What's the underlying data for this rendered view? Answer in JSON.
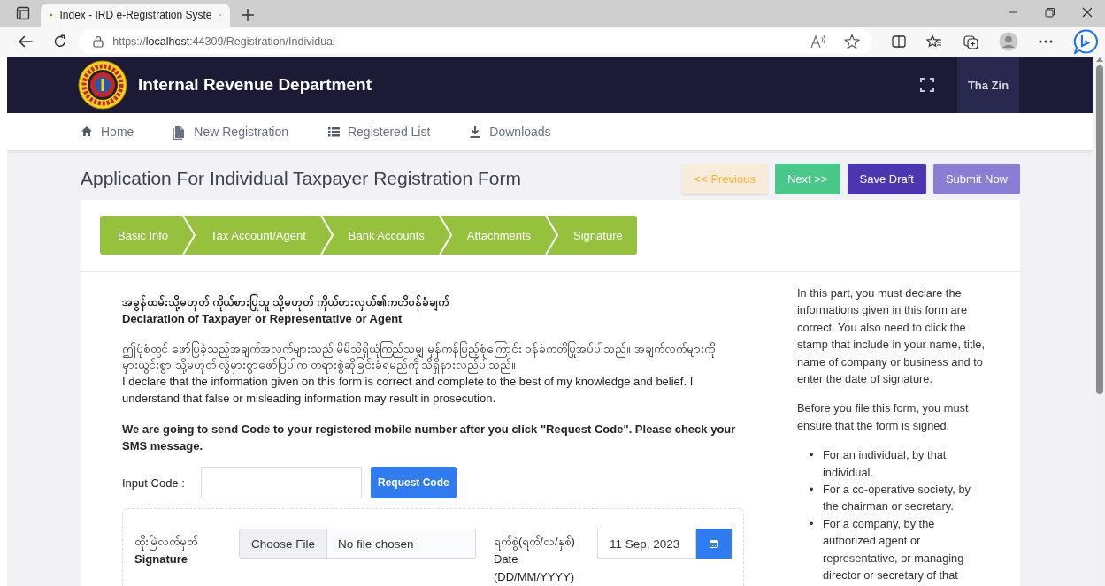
{
  "browser": {
    "tab_title": "Index - IRD e-Registration Syste",
    "url_scheme": "https://",
    "url_host": "localhost",
    "url_rest": ":44309/Registration/Individual"
  },
  "header": {
    "title": "Internal Revenue Department",
    "user": "Tha Zin"
  },
  "nav": [
    {
      "kind": "home",
      "label": "Home"
    },
    {
      "kind": "document",
      "label": "New Registration"
    },
    {
      "kind": "list",
      "label": "Registered List"
    },
    {
      "kind": "download",
      "label": "Downloads"
    }
  ],
  "page_title": "Application For Individual Taxpayer Registration Form",
  "actions": [
    {
      "kind": "previous",
      "label": "<< Previous"
    },
    {
      "kind": "next",
      "label": "Next >>"
    },
    {
      "kind": "draft",
      "label": "Save Draft"
    },
    {
      "kind": "submit",
      "label": "Submit Now"
    }
  ],
  "steps": [
    "Basic Info",
    "Tax Account/Agent",
    "Bank Accounts",
    "Attachments",
    "Signature"
  ],
  "declaration": {
    "heading_my": "အခွန်ထမ်းသို့မဟုတ် ကိုယ်စားပြုသူ သို့မဟုတ် ကိုယ်စားလှယ်၏ကတိဝန်ခံချက်",
    "heading_en": "Declaration of Taxpayer or Representative or Agent",
    "body_my": "ဤပုံစံတွင် ဖော်ပြခဲ့သည့်အချက်အလက်များသည် မိမိသိရှိယုံကြည်သမျှ မှန်ကန်ပြည့်စုံကြောင်း ဝန်ခံကတိပြုအပ်ပါသည်။ အချက်လက်များကို မှားယွင်းစွာ သို့မဟုတ် လွဲမှားစွာဖော်ပြပါက တရားစွဲဆိုခြင်းခံရမည်ကို သိရှိနားလည်ပါသည်။",
    "body_en": "I declare that the information given on this form is correct and complete to the best of my knowledge and belief. I understand that false or misleading information may result in prosecution.",
    "notice": "We are going to send Code to your registered mobile number after you click \"Request Code\". Please check your SMS message."
  },
  "code": {
    "label": "Input Code :",
    "button": "Request Code"
  },
  "signature": {
    "label_my": "ထိုးမြဲလက်မှတ်",
    "label_en": "Signature",
    "choose_button": "Choose File",
    "file_status": "No file chosen",
    "date_label_my": "ရက်စွဲ(ရက်/လ/နှစ်)",
    "date_label_en": "Date",
    "date_format": "(DD/MM/YYYY)",
    "date_value": "11 Sep, 2023"
  },
  "help": {
    "paragraphs": [
      "In this part, you must declare the informations given in this form are correct. You also need to click the stamp that include in your name, title, name of company or business and to enter the date of signature.",
      "Before you file this form, you must ensure that the form is signed."
    ],
    "items": [
      {
        "bullet": "•",
        "text": "For an individual, by that individual."
      },
      {
        "bullet": "•",
        "text": "For a co-operative society, by the chairman or secretary."
      },
      {
        "bullet": "•",
        "text": "For a company, by the authorized agent or representative, or managing director or secretary of that"
      }
    ]
  }
}
